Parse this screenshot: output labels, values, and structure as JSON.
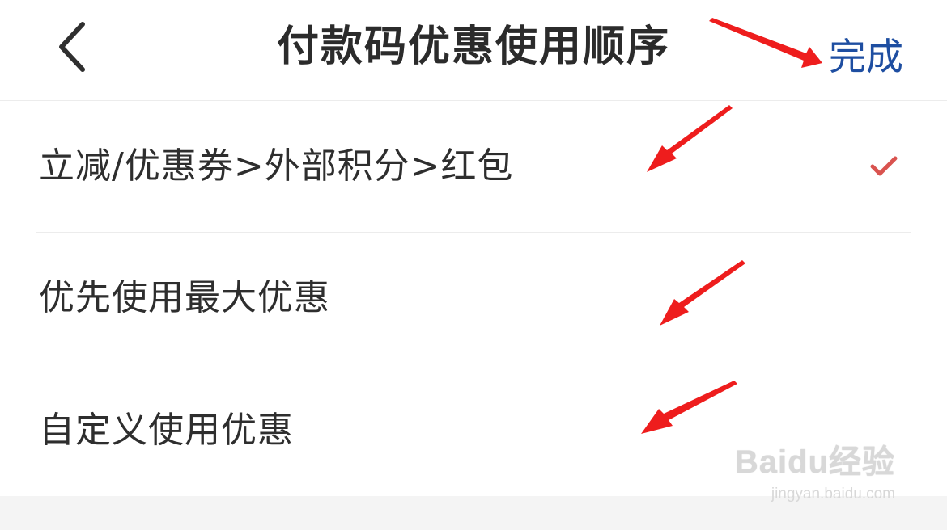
{
  "header": {
    "back_icon": "chevron-left-icon",
    "title": "付款码优惠使用顺序",
    "done_label": "完成",
    "done_color": "#1e4ea1"
  },
  "options": [
    {
      "label": "立减/优惠券>外部积分>红包",
      "selected": true
    },
    {
      "label": "优先使用最大优惠",
      "selected": false
    },
    {
      "label": "自定义使用优惠",
      "selected": false
    }
  ],
  "check_icon": "checkmark-icon",
  "check_color": "#d9534f",
  "annotation_arrow_color": "#ee1d1d",
  "watermark": {
    "brand": "Baidu经验",
    "url": "jingyan.baidu.com"
  }
}
